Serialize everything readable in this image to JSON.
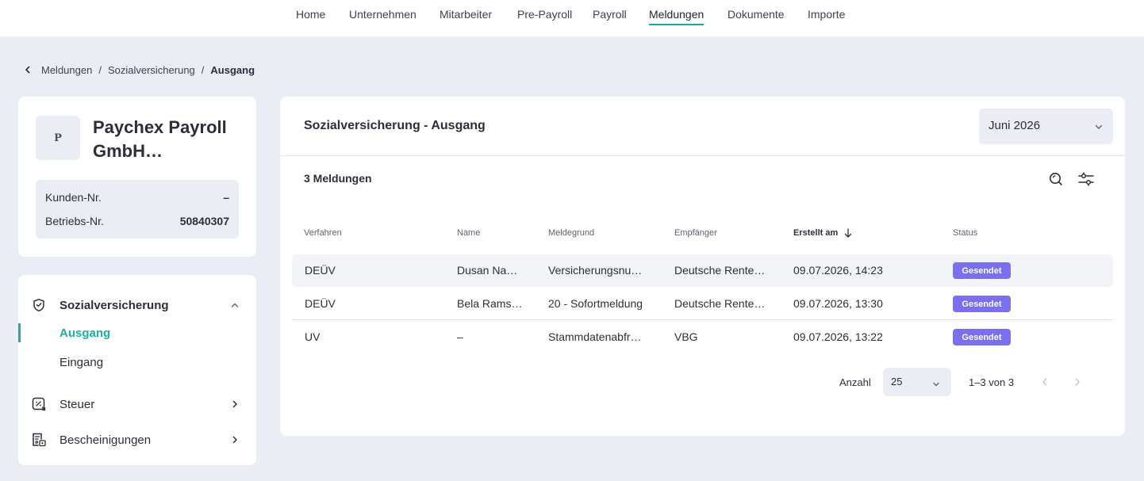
{
  "topnav": {
    "items": [
      "Home",
      "Unternehmen",
      "Mitarbeiter",
      "Pre-Payroll",
      "Payroll",
      "Meldungen",
      "Dokumente",
      "Importe"
    ],
    "active": "Meldungen"
  },
  "breadcrumb": {
    "items": [
      "Meldungen",
      "Sozialversicherung"
    ],
    "separator": "/",
    "current": "Ausgang"
  },
  "company": {
    "avatar": "P",
    "name_line1": "Paychex Payroll",
    "name_line2": "GmbH…",
    "customer_label": "Kunden-Nr.",
    "customer_value": "–",
    "betrieb_label": "Betriebs-Nr.",
    "betrieb_value": "50840307"
  },
  "sidenav": {
    "group1": {
      "label": "Sozialversicherung",
      "icon": "shield-icon",
      "expanded": true
    },
    "sub": [
      "Ausgang",
      "Eingang"
    ],
    "active_sub": "Ausgang",
    "group2": {
      "label": "Steuer",
      "icon": "tax-icon"
    },
    "group3": {
      "label": "Bescheinigungen",
      "icon": "certificate-icon"
    }
  },
  "main": {
    "title": "Sozialversicherung - Ausgang",
    "month": "Juni 2026",
    "count": "3 Meldungen",
    "columns": [
      "Verfahren",
      "Name",
      "Meldegrund",
      "Empfänger",
      "Erstellt am",
      "Status"
    ],
    "sorted_column": "Erstellt am",
    "rows": [
      {
        "verfahren": "DEÜV",
        "name": "Dusan Na…",
        "meldegrund": "Versicherungsnu…",
        "empfaenger": "Deutsche Rente…",
        "erstellt": "09.07.2026, 14:23",
        "status": "Gesendet"
      },
      {
        "verfahren": "DEÜV",
        "name": "Bela Rams…",
        "meldegrund": "20 - Sofortmeldung",
        "empfaenger": "Deutsche Rente…",
        "erstellt": "09.07.2026, 13:30",
        "status": "Gesendet"
      },
      {
        "verfahren": "UV",
        "name": "–",
        "meldegrund": "Stammdatenabfr…",
        "empfaenger": "VBG",
        "erstellt": "09.07.2026, 13:22",
        "status": "Gesendet"
      }
    ],
    "pager": {
      "label": "Anzahl",
      "page_size": "25",
      "range": "1–3 von 3"
    }
  },
  "colors": {
    "accent": "#1bb09f",
    "badge": "#7a6ff0",
    "background": "#ebedf4"
  }
}
